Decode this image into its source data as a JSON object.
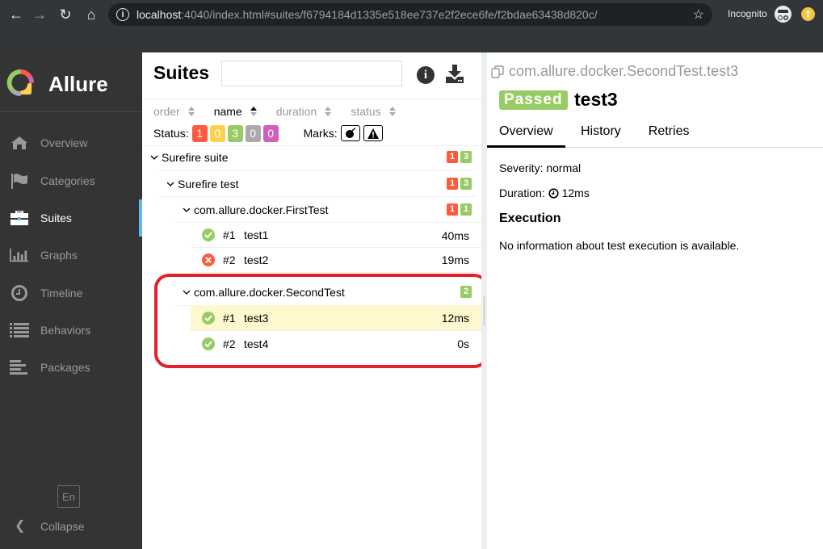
{
  "browser": {
    "url_host": "localhost",
    "url_rest": ":4040/index.html#suites/f6794184d1335e518ee737e2f2ece6fe/f2bdae63438d820c/",
    "profile_label": "Incognito"
  },
  "sidebar": {
    "brand": "Allure",
    "items": [
      {
        "label": "Overview",
        "icon": "home-icon",
        "active": false
      },
      {
        "label": "Categories",
        "icon": "flag-icon",
        "active": false
      },
      {
        "label": "Suites",
        "icon": "briefcase-icon",
        "active": true
      },
      {
        "label": "Graphs",
        "icon": "bar-chart-icon",
        "active": false
      },
      {
        "label": "Timeline",
        "icon": "clock-icon",
        "active": false
      },
      {
        "label": "Behaviors",
        "icon": "list-icon",
        "active": false
      },
      {
        "label": "Packages",
        "icon": "align-left-icon",
        "active": false
      }
    ],
    "language": "En",
    "collapse_label": "Collapse"
  },
  "tree": {
    "title": "Suites",
    "search_value": "",
    "sorters": [
      {
        "label": "order",
        "active": false
      },
      {
        "label": "name",
        "active": true
      },
      {
        "label": "duration",
        "active": false
      },
      {
        "label": "status",
        "active": false
      }
    ],
    "status_label": "Status:",
    "status_filters": [
      {
        "status": "failed",
        "count": "1",
        "color": "#fd5a3e"
      },
      {
        "status": "broken",
        "count": "0",
        "color": "#ffd050"
      },
      {
        "status": "passed",
        "count": "3",
        "color": "#97cc64"
      },
      {
        "status": "skipped",
        "count": "0",
        "color": "#aaaaaa"
      },
      {
        "status": "unknown",
        "count": "0",
        "color": "#d35ebe"
      }
    ],
    "marks_label": "Marks:",
    "nodes": [
      {
        "name": "Surefire suite",
        "failed": "1",
        "passed": "3"
      },
      {
        "name": "Surefire test",
        "failed": "1",
        "passed": "3"
      },
      {
        "name": "com.allure.docker.FirstTest",
        "failed": "1",
        "passed": "1"
      },
      {
        "name": "com.allure.docker.SecondTest",
        "passed": "2"
      }
    ],
    "leaves": [
      {
        "order": "#1",
        "name": "test1",
        "duration": "40ms",
        "status": "passed"
      },
      {
        "order": "#2",
        "name": "test2",
        "duration": "19ms",
        "status": "failed"
      },
      {
        "order": "#1",
        "name": "test3",
        "duration": "12ms",
        "status": "passed"
      },
      {
        "order": "#2",
        "name": "test4",
        "duration": "0s",
        "status": "passed"
      }
    ]
  },
  "detail": {
    "fullname": "com.allure.docker.SecondTest.test3",
    "status": "Passed",
    "name": "test3",
    "tabs": [
      "Overview",
      "History",
      "Retries"
    ],
    "active_tab": "Overview",
    "severity_label": "Severity:",
    "severity": "normal",
    "duration_label": "Duration:",
    "duration": "12ms",
    "execution_title": "Execution",
    "execution_text": "No information about test execution is available."
  },
  "colors": {
    "failed": "#fd5a3e",
    "passed": "#97cc64",
    "highlight": "#e4202a",
    "selected_row": "#fdf8ce"
  }
}
